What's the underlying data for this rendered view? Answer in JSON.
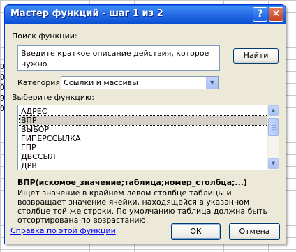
{
  "window": {
    "title": "Мастер функций - шаг 1 из 2",
    "help_glyph": "?",
    "close_glyph": "✕"
  },
  "search": {
    "label": "Поиск функции:",
    "value": "Введите краткое описание действия, которое нужно\nвыполнить, и нажмите кнопку \"Найти\"",
    "find_button": "Найти"
  },
  "category": {
    "label": "Категория:",
    "value": "Ссылки и массивы",
    "arrow_icon": "chevron-down-icon"
  },
  "function_list": {
    "label": "Выберите функцию:",
    "items": [
      "АДРЕС",
      "ВПР",
      "ВЫБОР",
      "ГИПЕРССЫЛКА",
      "ГПР",
      "ДВССЫЛ",
      "ДРВ"
    ],
    "selected_index": 1
  },
  "function_info": {
    "syntax": "ВПР(искомое_значение;таблица;номер_столбца;...)",
    "description": "Ищет значение в крайнем левом столбце таблицы и возвращает значение ячейки, находящейся в указанном столбце той же строки. По умолчанию таблица должна быть отсортирована по возрастанию."
  },
  "footer": {
    "help_link": "Справка по этой функции",
    "ok_button": "ОК",
    "cancel_button": "Отмена"
  },
  "background_cells": [
    "0",
    "0",
    "0",
    "9",
    "0"
  ]
}
